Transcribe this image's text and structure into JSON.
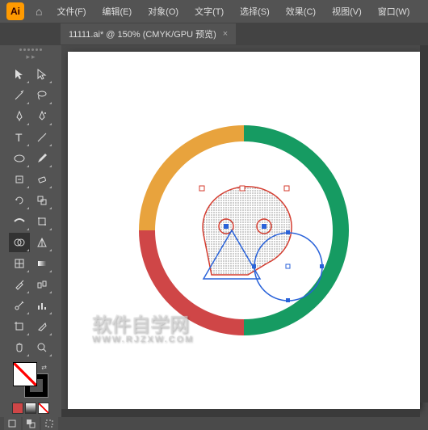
{
  "app": {
    "logo": "Ai"
  },
  "menu": {
    "items": [
      "文件(F)",
      "编辑(E)",
      "对象(O)",
      "文字(T)",
      "选择(S)",
      "效果(C)",
      "视图(V)",
      "窗口(W)"
    ]
  },
  "tab": {
    "label": "11111.ai* @ 150% (CMYK/GPU 预览)",
    "close": "×"
  },
  "tools": {
    "items": [
      "selection",
      "direct-selection",
      "magic-wand",
      "lasso",
      "pen",
      "curvature",
      "type",
      "line",
      "rectangle",
      "paintbrush",
      "shaper",
      "eraser",
      "rotate",
      "scale",
      "width",
      "free-transform",
      "shape-builder",
      "perspective",
      "mesh",
      "gradient",
      "eyedropper",
      "blend",
      "symbol-sprayer",
      "column-graph",
      "artboard",
      "slice",
      "hand",
      "zoom"
    ]
  },
  "watermark": {
    "main": "软件自学网",
    "sub": "WWW.RJZXW.COM"
  },
  "colors": {
    "ring_green": "#169b62",
    "ring_orange": "#e8a33d",
    "ring_red": "#cf4647",
    "sel_red": "#d43c2f",
    "sel_blue": "#2962d9"
  }
}
